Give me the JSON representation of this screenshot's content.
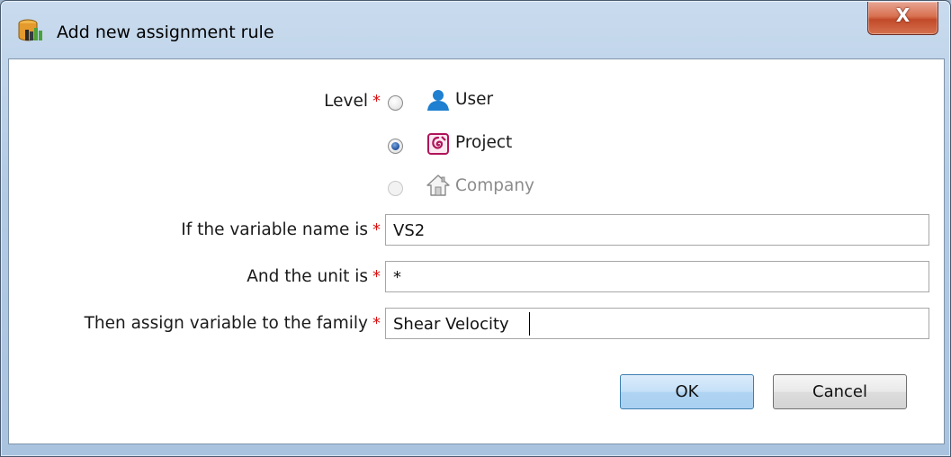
{
  "window": {
    "title": "Add new assignment rule",
    "close_label": "X"
  },
  "form": {
    "required_mark": "*",
    "level": {
      "label": "Level",
      "options": [
        {
          "label": "User",
          "icon": "user-icon",
          "selected": false,
          "disabled": false
        },
        {
          "label": "Project",
          "icon": "project-icon",
          "selected": true,
          "disabled": false
        },
        {
          "label": "Company",
          "icon": "company-house-icon",
          "selected": false,
          "disabled": true
        }
      ]
    },
    "variable_name": {
      "label": "If the variable name is",
      "value": "VS2"
    },
    "unit": {
      "label": "And the unit is",
      "value": "*"
    },
    "family": {
      "label": "Then assign variable to the family",
      "value": "Shear Velocity"
    }
  },
  "buttons": {
    "ok_label": "OK",
    "cancel_label": "Cancel"
  },
  "colors": {
    "required_star": "#dd1111",
    "user_icon": "#1f7fd0",
    "project_icon": "#b0145a",
    "ok_button": "#b0d4f3",
    "close_button": "#c24a2a"
  }
}
